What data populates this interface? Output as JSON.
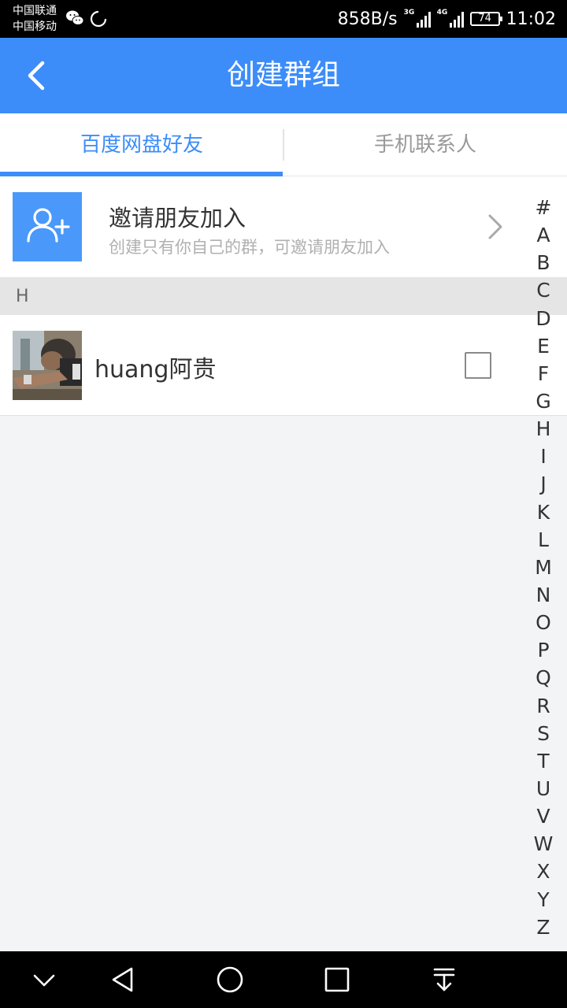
{
  "status_bar": {
    "carrier_1": "中国联通",
    "carrier_2": "中国移动",
    "network_speed": "858B/s",
    "signal_1_tag": "3G",
    "signal_2_tag": "4G",
    "battery": "74",
    "time": "11:02"
  },
  "header": {
    "title": "创建群组"
  },
  "tabs": [
    {
      "label": "百度网盘好友",
      "active": true
    },
    {
      "label": "手机联系人",
      "active": false
    }
  ],
  "invite": {
    "title": "邀请朋友加入",
    "subtitle": "创建只有你自己的群，可邀请朋友加入"
  },
  "sections": [
    {
      "letter": "H",
      "contacts": [
        {
          "name": "huang阿贵",
          "checked": false
        }
      ]
    }
  ],
  "alphabet_index": [
    "#",
    "A",
    "B",
    "C",
    "D",
    "E",
    "F",
    "G",
    "H",
    "I",
    "J",
    "K",
    "L",
    "M",
    "N",
    "O",
    "P",
    "Q",
    "R",
    "S",
    "T",
    "U",
    "V",
    "W",
    "X",
    "Y",
    "Z"
  ],
  "colors": {
    "accent": "#3c8df9",
    "status_bar": "#000000",
    "nav_bar": "#000000",
    "page_background": "#f3f4f6"
  }
}
